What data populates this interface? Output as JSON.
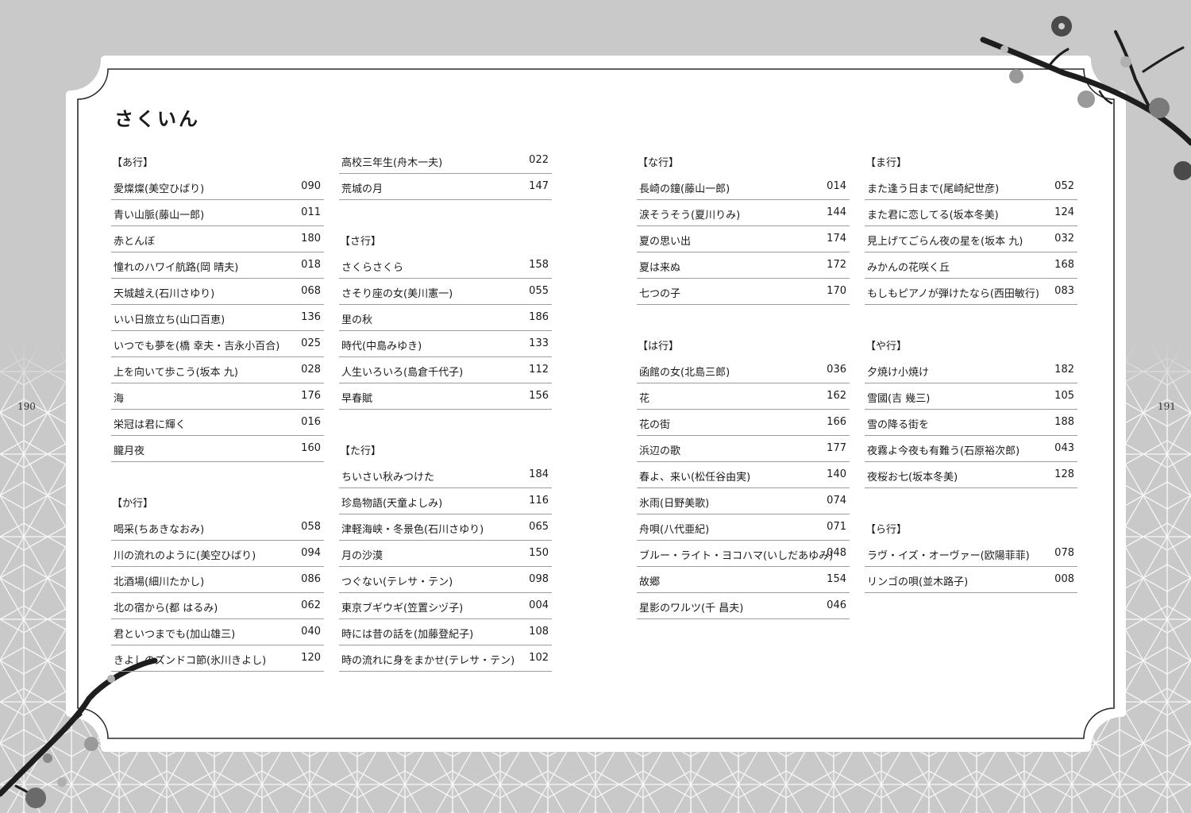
{
  "title": "さくいん",
  "page_left": "190",
  "page_right": "191",
  "columns": [
    [
      {
        "kind": "head",
        "label": "【あ行】"
      },
      {
        "kind": "entry",
        "title": "愛燦燦(美空ひばり)",
        "page": "090"
      },
      {
        "kind": "entry",
        "title": "青い山脈(藤山一郎)",
        "page": "011"
      },
      {
        "kind": "entry",
        "title": "赤とんぼ",
        "page": "180"
      },
      {
        "kind": "entry",
        "title": "憧れのハワイ航路(岡 晴夫)",
        "page": "018"
      },
      {
        "kind": "entry",
        "title": "天城越え(石川さゆり)",
        "page": "068"
      },
      {
        "kind": "entry",
        "title": "いい日旅立ち(山口百恵)",
        "page": "136"
      },
      {
        "kind": "entry",
        "title": "いつでも夢を(橋 幸夫・吉永小百合)",
        "page": "025"
      },
      {
        "kind": "entry",
        "title": "上を向いて歩こう(坂本 九)",
        "page": "028"
      },
      {
        "kind": "entry",
        "title": "海",
        "page": "176"
      },
      {
        "kind": "entry",
        "title": "栄冠は君に輝く",
        "page": "016"
      },
      {
        "kind": "entry",
        "title": "朧月夜",
        "page": "160"
      },
      {
        "kind": "gap"
      },
      {
        "kind": "head",
        "label": "【か行】"
      },
      {
        "kind": "entry",
        "title": "喝采(ちあきなおみ)",
        "page": "058"
      },
      {
        "kind": "entry",
        "title": "川の流れのように(美空ひばり)",
        "page": "094"
      },
      {
        "kind": "entry",
        "title": "北酒場(細川たかし)",
        "page": "086"
      },
      {
        "kind": "entry",
        "title": "北の宿から(都 はるみ)",
        "page": "062"
      },
      {
        "kind": "entry",
        "title": "君といつまでも(加山雄三)",
        "page": "040"
      },
      {
        "kind": "entry",
        "title": "きよしのズンドコ節(氷川きよし)",
        "page": "120"
      }
    ],
    [
      {
        "kind": "entry",
        "title": "高校三年生(舟木一夫)",
        "page": "022"
      },
      {
        "kind": "entry",
        "title": "荒城の月",
        "page": "147"
      },
      {
        "kind": "gap"
      },
      {
        "kind": "head",
        "label": "【さ行】"
      },
      {
        "kind": "entry",
        "title": "さくらさくら",
        "page": "158"
      },
      {
        "kind": "entry",
        "title": "さそり座の女(美川憲一)",
        "page": "055"
      },
      {
        "kind": "entry",
        "title": "里の秋",
        "page": "186"
      },
      {
        "kind": "entry",
        "title": "時代(中島みゆき)",
        "page": "133"
      },
      {
        "kind": "entry",
        "title": "人生いろいろ(島倉千代子)",
        "page": "112"
      },
      {
        "kind": "entry",
        "title": "早春賦",
        "page": "156"
      },
      {
        "kind": "gap"
      },
      {
        "kind": "head",
        "label": "【た行】"
      },
      {
        "kind": "entry",
        "title": "ちいさい秋みつけた",
        "page": "184"
      },
      {
        "kind": "entry",
        "title": "珍島物語(天童よしみ)",
        "page": "116"
      },
      {
        "kind": "entry",
        "title": "津軽海峡・冬景色(石川さゆり)",
        "page": "065"
      },
      {
        "kind": "entry",
        "title": "月の沙漠",
        "page": "150"
      },
      {
        "kind": "entry",
        "title": "つぐない(テレサ・テン)",
        "page": "098"
      },
      {
        "kind": "entry",
        "title": "東京ブギウギ(笠置シヅ子)",
        "page": "004"
      },
      {
        "kind": "entry",
        "title": "時には昔の話を(加藤登紀子)",
        "page": "108"
      },
      {
        "kind": "entry",
        "title": "時の流れに身をまかせ(テレサ・テン)",
        "page": "102"
      }
    ],
    [
      {
        "kind": "head",
        "label": "【な行】"
      },
      {
        "kind": "entry",
        "title": "長崎の鐘(藤山一郎)",
        "page": "014"
      },
      {
        "kind": "entry",
        "title": "涙そうそう(夏川りみ)",
        "page": "144"
      },
      {
        "kind": "entry",
        "title": "夏の思い出",
        "page": "174"
      },
      {
        "kind": "entry",
        "title": "夏は来ぬ",
        "page": "172"
      },
      {
        "kind": "entry",
        "title": "七つの子",
        "page": "170"
      },
      {
        "kind": "gap"
      },
      {
        "kind": "head",
        "label": "【は行】"
      },
      {
        "kind": "entry",
        "title": "函館の女(北島三郎)",
        "page": "036"
      },
      {
        "kind": "entry",
        "title": "花",
        "page": "162"
      },
      {
        "kind": "entry",
        "title": "花の街",
        "page": "166"
      },
      {
        "kind": "entry",
        "title": "浜辺の歌",
        "page": "177"
      },
      {
        "kind": "entry",
        "title": "春よ、来い(松任谷由実)",
        "page": "140"
      },
      {
        "kind": "entry",
        "title": "氷雨(日野美歌)",
        "page": "074"
      },
      {
        "kind": "entry",
        "title": "舟唄(八代亜紀)",
        "page": "071"
      },
      {
        "kind": "entry",
        "title": "ブルー・ライト・ヨコハマ(いしだあゆみ)",
        "page": "048"
      },
      {
        "kind": "entry",
        "title": "故郷",
        "page": "154"
      },
      {
        "kind": "entry",
        "title": "星影のワルツ(千 昌夫)",
        "page": "046"
      }
    ],
    [
      {
        "kind": "head",
        "label": "【ま行】"
      },
      {
        "kind": "entry",
        "title": "また逢う日まで(尾崎紀世彦)",
        "page": "052"
      },
      {
        "kind": "entry",
        "title": "また君に恋してる(坂本冬美)",
        "page": "124"
      },
      {
        "kind": "entry",
        "title": "見上げてごらん夜の星を(坂本 九)",
        "page": "032"
      },
      {
        "kind": "entry",
        "title": "みかんの花咲く丘",
        "page": "168"
      },
      {
        "kind": "entry",
        "title": "もしもピアノが弾けたなら(西田敏行)",
        "page": "083"
      },
      {
        "kind": "gap"
      },
      {
        "kind": "head",
        "label": "【や行】"
      },
      {
        "kind": "entry",
        "title": "夕焼け小焼け",
        "page": "182"
      },
      {
        "kind": "entry",
        "title": "雪國(吉 幾三)",
        "page": "105"
      },
      {
        "kind": "entry",
        "title": "雪の降る街を",
        "page": "188"
      },
      {
        "kind": "entry",
        "title": "夜霧よ今夜も有難う(石原裕次郎)",
        "page": "043"
      },
      {
        "kind": "entry",
        "title": "夜桜お七(坂本冬美)",
        "page": "128"
      },
      {
        "kind": "gap"
      },
      {
        "kind": "head",
        "label": "【ら行】"
      },
      {
        "kind": "entry",
        "title": "ラヴ・イズ・オーヴァー(欧陽菲菲)",
        "page": "078"
      },
      {
        "kind": "entry",
        "title": "リンゴの唄(並木路子)",
        "page": "008"
      }
    ]
  ]
}
